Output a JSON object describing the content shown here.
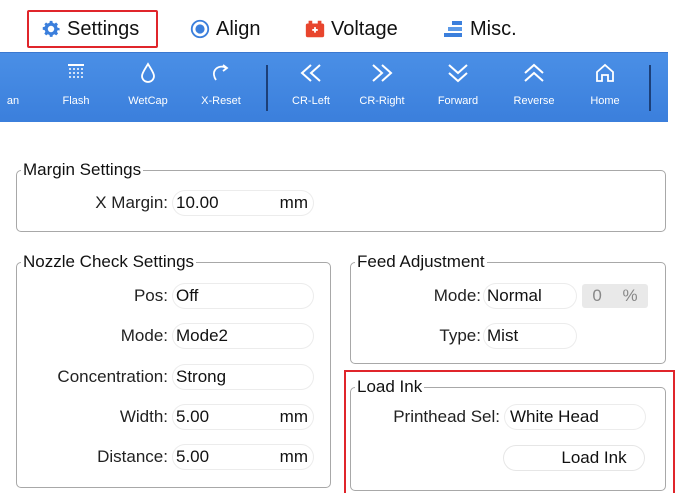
{
  "tabs": [
    {
      "label": "Settings",
      "icon": "gear-icon",
      "selected": true
    },
    {
      "label": "Align",
      "icon": "target-icon"
    },
    {
      "label": "Voltage",
      "icon": "battery-icon"
    },
    {
      "label": "Misc.",
      "icon": "layers-icon"
    }
  ],
  "toolbar": {
    "items": [
      {
        "label": "an",
        "icon": "clean-icon"
      },
      {
        "label": "Flash",
        "icon": "flash-nozzle-icon"
      },
      {
        "label": "WetCap",
        "icon": "drop-icon"
      },
      {
        "label": "X-Reset",
        "icon": "reset-arrow-icon"
      },
      {
        "label": "CR-Left",
        "icon": "double-chevron-left-icon"
      },
      {
        "label": "CR-Right",
        "icon": "double-chevron-right-icon"
      },
      {
        "label": "Forward",
        "icon": "double-chevron-down-icon"
      },
      {
        "label": "Reverse",
        "icon": "double-chevron-up-icon"
      },
      {
        "label": "Home",
        "icon": "home-icon"
      }
    ]
  },
  "margin": {
    "title": "Margin Settings",
    "x_margin_label": "X Margin:",
    "x_margin_value": "10.00",
    "x_margin_unit": "mm"
  },
  "nozzle": {
    "title": "Nozzle Check Settings",
    "pos_label": "Pos:",
    "pos_value": "Off",
    "mode_label": "Mode:",
    "mode_value": "Mode2",
    "conc_label": "Concentration:",
    "conc_value": "Strong",
    "width_label": "Width:",
    "width_value": "5.00",
    "width_unit": "mm",
    "dist_label": "Distance:",
    "dist_value": "5.00",
    "dist_unit": "mm"
  },
  "feed": {
    "title": "Feed Adjustment",
    "mode_label": "Mode:",
    "mode_value": "Normal",
    "pct_value": "0",
    "pct_unit": "%",
    "type_label": "Type:",
    "type_value": "Mist"
  },
  "load_ink": {
    "title": "Load Ink",
    "head_label": "Printhead Sel:",
    "head_value": "White Head",
    "button_label": "Load Ink"
  },
  "colors": {
    "toolbar_blue": "#3b7fdc",
    "highlight_red": "#e0252b"
  }
}
